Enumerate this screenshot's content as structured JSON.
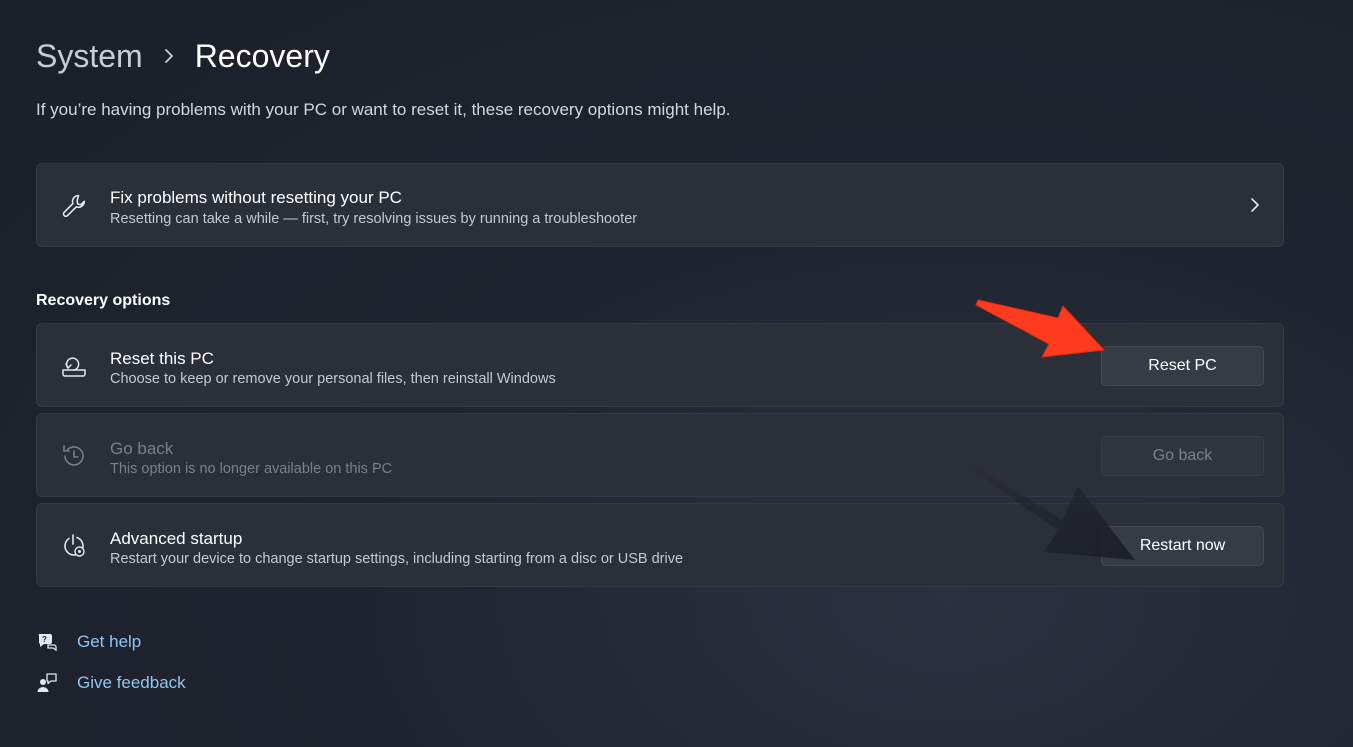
{
  "breadcrumb": {
    "parent": "System",
    "current": "Recovery"
  },
  "intro": "If you’re having problems with your PC or want to reset it, these recovery options might help.",
  "fix_card": {
    "title": "Fix problems without resetting your PC",
    "subtitle": "Resetting can take a while — first, try resolving issues by running a troubleshooter",
    "icon": "wrench-icon"
  },
  "section_title": "Recovery options",
  "options": [
    {
      "title": "Reset this PC",
      "subtitle": "Choose to keep or remove your personal files, then reinstall Windows",
      "button": "Reset PC",
      "icon": "reset-pc-icon",
      "enabled": true
    },
    {
      "title": "Go back",
      "subtitle": "This option is no longer available on this PC",
      "button": "Go back",
      "icon": "history-icon",
      "enabled": false
    },
    {
      "title": "Advanced startup",
      "subtitle": "Restart your device to change startup settings, including starting from a disc or USB drive",
      "button": "Restart now",
      "icon": "power-gear-icon",
      "enabled": true
    }
  ],
  "links": [
    {
      "label": "Get help",
      "icon": "help-chat-icon"
    },
    {
      "label": "Give feedback",
      "icon": "feedback-icon"
    }
  ],
  "annotations": [
    {
      "kind": "arrow",
      "color": "#ff3b1f",
      "points_to": "Reset PC"
    },
    {
      "kind": "arrow",
      "color": "#1a1c24",
      "points_to": "Restart now"
    }
  ]
}
